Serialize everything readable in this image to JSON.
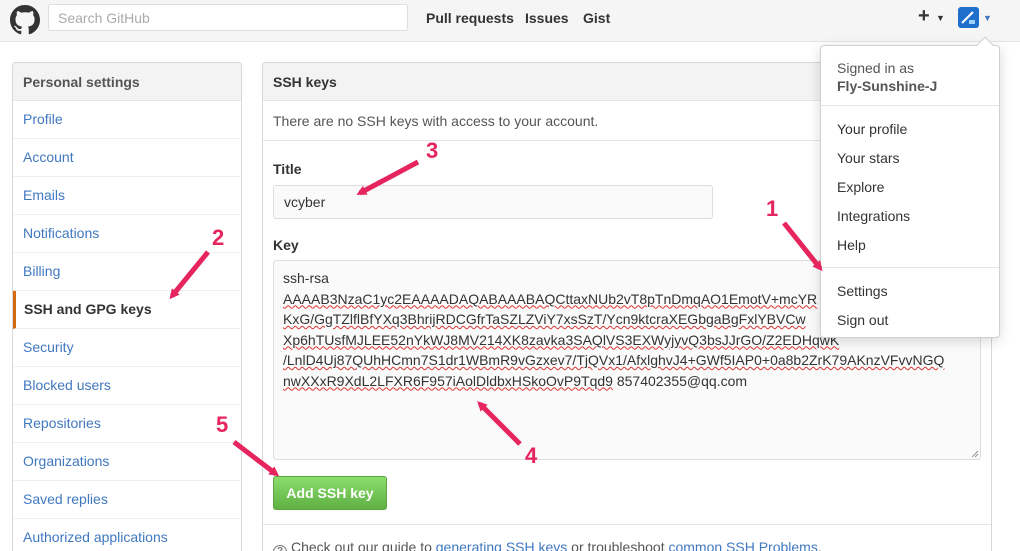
{
  "header": {
    "search_placeholder": "Search GitHub",
    "nav": [
      "Pull requests",
      "Issues",
      "Gist"
    ],
    "plus_label": "+"
  },
  "sidebar": {
    "title": "Personal settings",
    "items": [
      {
        "label": "Profile"
      },
      {
        "label": "Account"
      },
      {
        "label": "Emails"
      },
      {
        "label": "Notifications"
      },
      {
        "label": "Billing"
      },
      {
        "label": "SSH and GPG keys",
        "active": true
      },
      {
        "label": "Security"
      },
      {
        "label": "Blocked users"
      },
      {
        "label": "Repositories"
      },
      {
        "label": "Organizations"
      },
      {
        "label": "Saved replies"
      },
      {
        "label": "Authorized applications"
      }
    ]
  },
  "main": {
    "title": "SSH keys",
    "blankslate": "There are no SSH keys with access to your account.",
    "title_label": "Title",
    "title_value": "vcyber",
    "key_label": "Key",
    "key_lines": [
      "ssh-rsa",
      "AAAAB3NzaC1yc2EAAAADAQABAAABAQCttaxNUb2vT8pTnDmqAO1EmotV+mcYR",
      "KxG/GgTZlflBfYXq3BhrijRDCGfrTaSZLZViY7xsSzT/Ycn9ktcraXEGbgaBgFxlYBVCw",
      "Xp6hTUsfMJLEE52nYkWJ8MV214XK8zavka3SAQlVS3EXWyjyvQ3bsJJrGO/Z2EDHqwK",
      "/LnlD4Uj87QUhHCmn7S1dr1WBmR9vGzxev7/TjQVx1/AfxlghvJ4+GWf5IAP0+0a8b2ZrK79AKnzVFvvNGQ",
      "nwXXxR9XdL2LFXR6F957iAolDldbxHSkoOvP9Tqd9",
      "857402355@qq.com"
    ],
    "add_button": "Add SSH key",
    "footer": {
      "prefix": "Check out our guide to ",
      "link1": "generating SSH keys",
      "middle": " or troubleshoot ",
      "link2": "common SSH Problems",
      "suffix": "."
    }
  },
  "dropdown": {
    "signed_in_as": "Signed in as",
    "username": "Fly-Sunshine-J",
    "items": [
      "Your profile",
      "Your stars",
      "Explore",
      "Integrations",
      "Help"
    ],
    "items2": [
      "Settings",
      "Sign out"
    ]
  },
  "annotations": [
    "1",
    "2",
    "3",
    "4",
    "5"
  ],
  "colors": {
    "link": "#4078c0",
    "accent_active": "#d26911",
    "button_green": "#60b044",
    "annotation": "#e6245e"
  }
}
